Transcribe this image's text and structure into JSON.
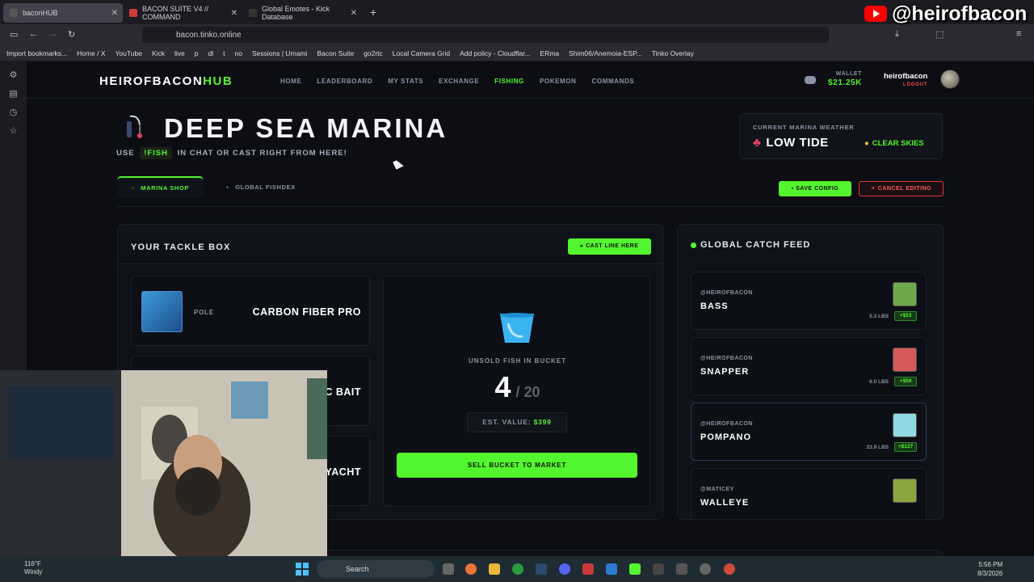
{
  "browser": {
    "tabs": [
      {
        "label": "baconHUB",
        "active": true
      },
      {
        "label": "BACON SUITE V4 // COMMAND",
        "active": false
      },
      {
        "label": "Global Emotes - Kick Database",
        "active": false
      }
    ],
    "url": "bacon.tinko.online",
    "bookmarks": [
      "Import bookmarks...",
      "Home / X",
      "YouTube",
      "Kick",
      "live",
      "p",
      "dl",
      "t",
      "no",
      "Sessions | Umami",
      "Bacon Suite",
      "go2rtc",
      "Local Camera Grid",
      "Add policy - Cloudflar...",
      "ERma",
      "Shim06/Anemoia-ESP...",
      "Tinko Overlay"
    ]
  },
  "overlay": {
    "handle": "@heirofbacon"
  },
  "header": {
    "logo_main": "HEIROFBACON",
    "logo_accent": "HUB",
    "nav": [
      {
        "label": "HOME",
        "active": false
      },
      {
        "label": "LEADERBOARD",
        "active": false
      },
      {
        "label": "MY STATS",
        "active": false
      },
      {
        "label": "EXCHANGE",
        "active": false
      },
      {
        "label": "FISHING",
        "active": true
      },
      {
        "label": "POKEMON",
        "active": false
      },
      {
        "label": "COMMANDS",
        "active": false
      }
    ],
    "wallet_label": "WALLET",
    "wallet_amount": "$21.25K",
    "username": "heirofbacon",
    "logout": "LOGOUT"
  },
  "hero": {
    "title": "DEEP SEA MARINA",
    "subtitle_pre": "USE",
    "command": "!FISH",
    "subtitle_post": "IN CHAT OR CAST RIGHT FROM HERE!"
  },
  "weather": {
    "label": "CURRENT MARINA WEATHER",
    "tide": "LOW TIDE",
    "sky": "CLEAR SKIES"
  },
  "tabs": [
    {
      "label": "MARINA SHOP",
      "active": true
    },
    {
      "label": "GLOBAL FISHDEX",
      "active": false
    }
  ],
  "actions": {
    "save": "SAVE CONFIG",
    "cancel": "CANCEL EDITING"
  },
  "tackle": {
    "title": "YOUR TACKLE BOX",
    "cast": "CAST LINE HERE",
    "items": [
      {
        "type": "POLE",
        "name": "CARBON FIBER PRO"
      },
      {
        "type": "",
        "name": "C BAIT"
      },
      {
        "type": "",
        "name": "YACHT"
      }
    ]
  },
  "bucket": {
    "label": "UNSOLD FISH IN BUCKET",
    "count": "4",
    "max": "/ 20",
    "est_label": "EST. VALUE:",
    "est_value": "$399",
    "sell": "SELL BUCKET TO MARKET"
  },
  "feed": {
    "title": "GLOBAL CATCH FEED",
    "items": [
      {
        "user": "@HEIROFBACON",
        "fish": "BASS",
        "lbs": "5.3 LBS",
        "value": "+$53",
        "color": "#6fa84a"
      },
      {
        "user": "@HEIROFBACON",
        "fish": "SNAPPER",
        "lbs": "6.0 LBS",
        "value": "+$59",
        "color": "#d45a5a"
      },
      {
        "user": "@HEIROFBACON",
        "fish": "POMPANO",
        "lbs": "23.9 LBS",
        "value": "+$127",
        "color": "#8fd8e0"
      },
      {
        "user": "@MATICEY",
        "fish": "WALLEYE",
        "lbs": "",
        "value": "",
        "color": "#8aa640"
      }
    ]
  },
  "taskbar": {
    "temp": "116°F",
    "condition": "Windy",
    "search": "Search",
    "time": "5:56 PM",
    "date": "8/3/2026"
  },
  "colors": {
    "accent": "#53f52e",
    "danger": "#e03a3a",
    "bg": "#0c0e14"
  }
}
